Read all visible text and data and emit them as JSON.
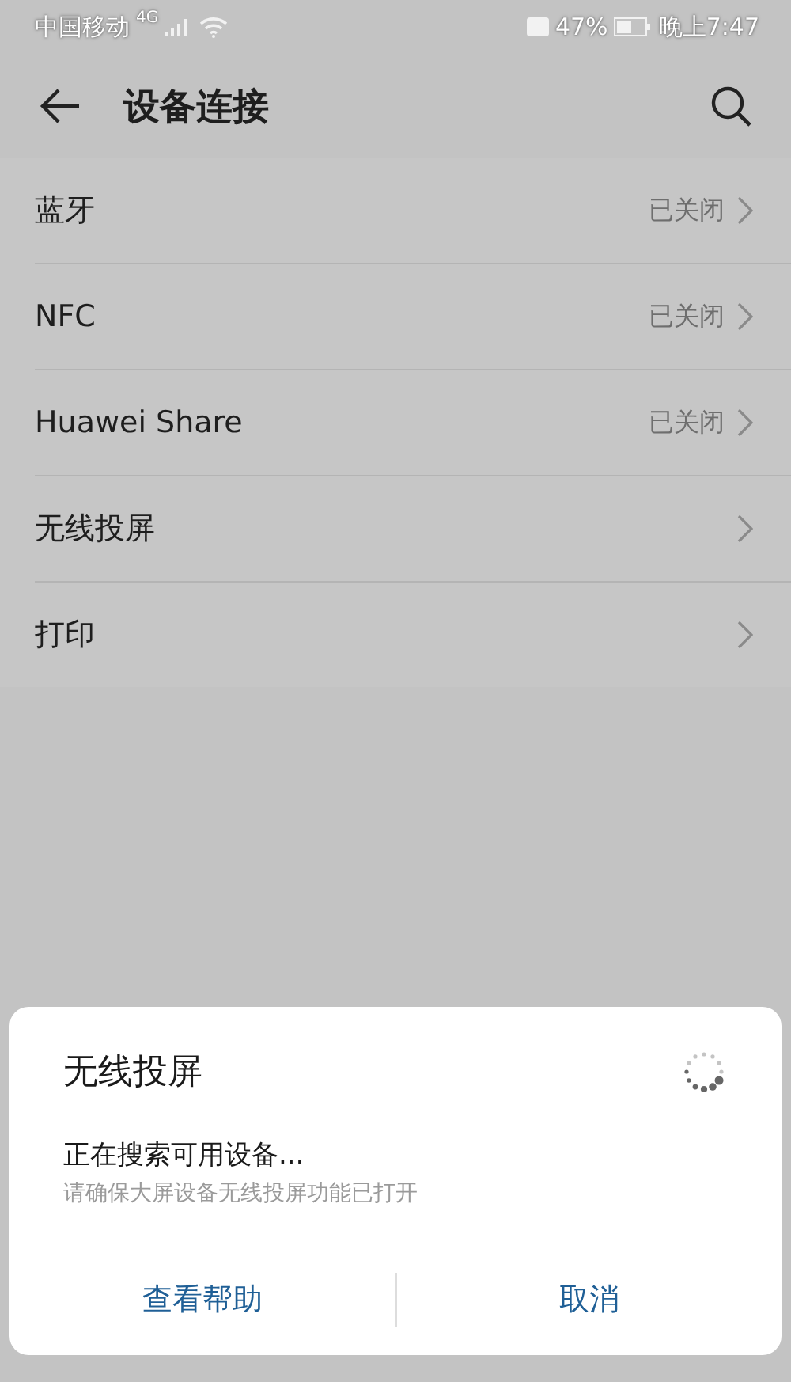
{
  "status_bar": {
    "carrier": "中国移动",
    "network": "4G",
    "battery": "47%",
    "time": "晚上7:47"
  },
  "header": {
    "title": "设备连接"
  },
  "items": [
    {
      "label": "蓝牙",
      "value": "已关闭"
    },
    {
      "label": "NFC",
      "value": "已关闭"
    },
    {
      "label": "Huawei Share",
      "value": "已关闭"
    },
    {
      "label": "无线投屏"
    },
    {
      "label": "打印"
    }
  ],
  "dialog": {
    "title": "无线投屏",
    "message": "正在搜索可用设备...",
    "hint": "请确保大屏设备无线投屏功能已打开",
    "buttons": [
      "查看帮助",
      "取消"
    ]
  }
}
